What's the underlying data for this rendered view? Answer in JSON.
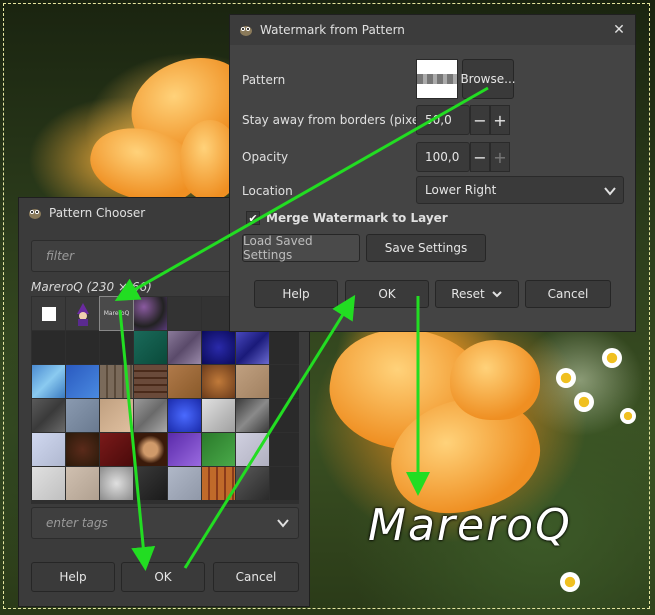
{
  "background": {
    "watermark_text": "MareroQ"
  },
  "watermark_dialog": {
    "title": "Watermark from Pattern",
    "pattern_label": "Pattern",
    "browse_label": "Browse...",
    "borders_label": "Stay away from borders (pixels)",
    "borders_value": "50,0",
    "opacity_label": "Opacity",
    "opacity_value": "100,0",
    "location_label": "Location",
    "location_value": "Lower Right",
    "merge_label": "Merge Watermark to Layer",
    "merge_checked": true,
    "load_settings_label": "Load Saved Settings",
    "save_settings_label": "Save Settings",
    "help_label": "Help",
    "ok_label": "OK",
    "reset_label": "Reset",
    "cancel_label": "Cancel"
  },
  "pattern_chooser": {
    "title": "Pattern Chooser",
    "filter_placeholder": "filter",
    "selected_pattern": "MareroQ (230 × 66)",
    "selected_thumb_text": "MareroQ",
    "tags_placeholder": "enter tags",
    "help_label": "Help",
    "ok_label": "OK",
    "cancel_label": "Cancel"
  },
  "colors": {
    "arrow": "#22dd22",
    "dialog_bg": "#444444",
    "button_bg": "#3a3a3a"
  }
}
